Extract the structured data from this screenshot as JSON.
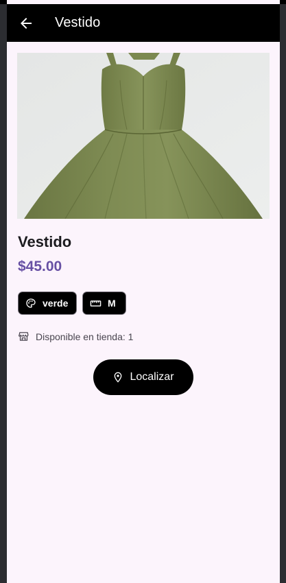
{
  "app_bar": {
    "title": "Vestido",
    "back_icon": "arrow-back-icon"
  },
  "product": {
    "image_description_icon": "dress-photo",
    "name": "Vestido",
    "price": "$45.00",
    "color_chip": {
      "icon": "palette-icon",
      "label": "verde"
    },
    "size_chip": {
      "icon": "ruler-icon",
      "label": "M"
    },
    "availability": {
      "icon": "store-icon",
      "text": "Disponible en tienda: 1"
    }
  },
  "actions": {
    "locate_icon": "location-pin-icon",
    "locate_label": "Localizar"
  },
  "colors": {
    "accent_price": "#6750a4",
    "app_bar": "#000000",
    "background": "#fcf4fc",
    "dress": "#7d8a52"
  }
}
